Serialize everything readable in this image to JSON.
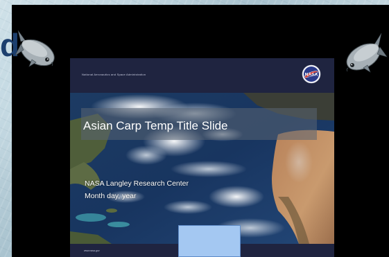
{
  "background": {
    "partial_heading": "d",
    "colors": {
      "backdrop": "#b9d0da",
      "panel": "#000000",
      "heading": "#1c3f6e"
    }
  },
  "slide": {
    "agency_name": "National Aeronautics and Space Administration",
    "logo_text": "NASA",
    "title": "Asian Carp Temp Title Slide",
    "center": "NASA Langley Research Center",
    "date": "Month day, year",
    "footer_url": "www.nasa.gov",
    "colors": {
      "header": "#1f2440",
      "title_band": "#5a6473",
      "placeholder_box": "#a4c8f2"
    }
  },
  "icons": {
    "left_fish": "asian-carp-icon",
    "right_fish": "asian-carp-icon",
    "logo": "nasa-meatball-logo"
  }
}
